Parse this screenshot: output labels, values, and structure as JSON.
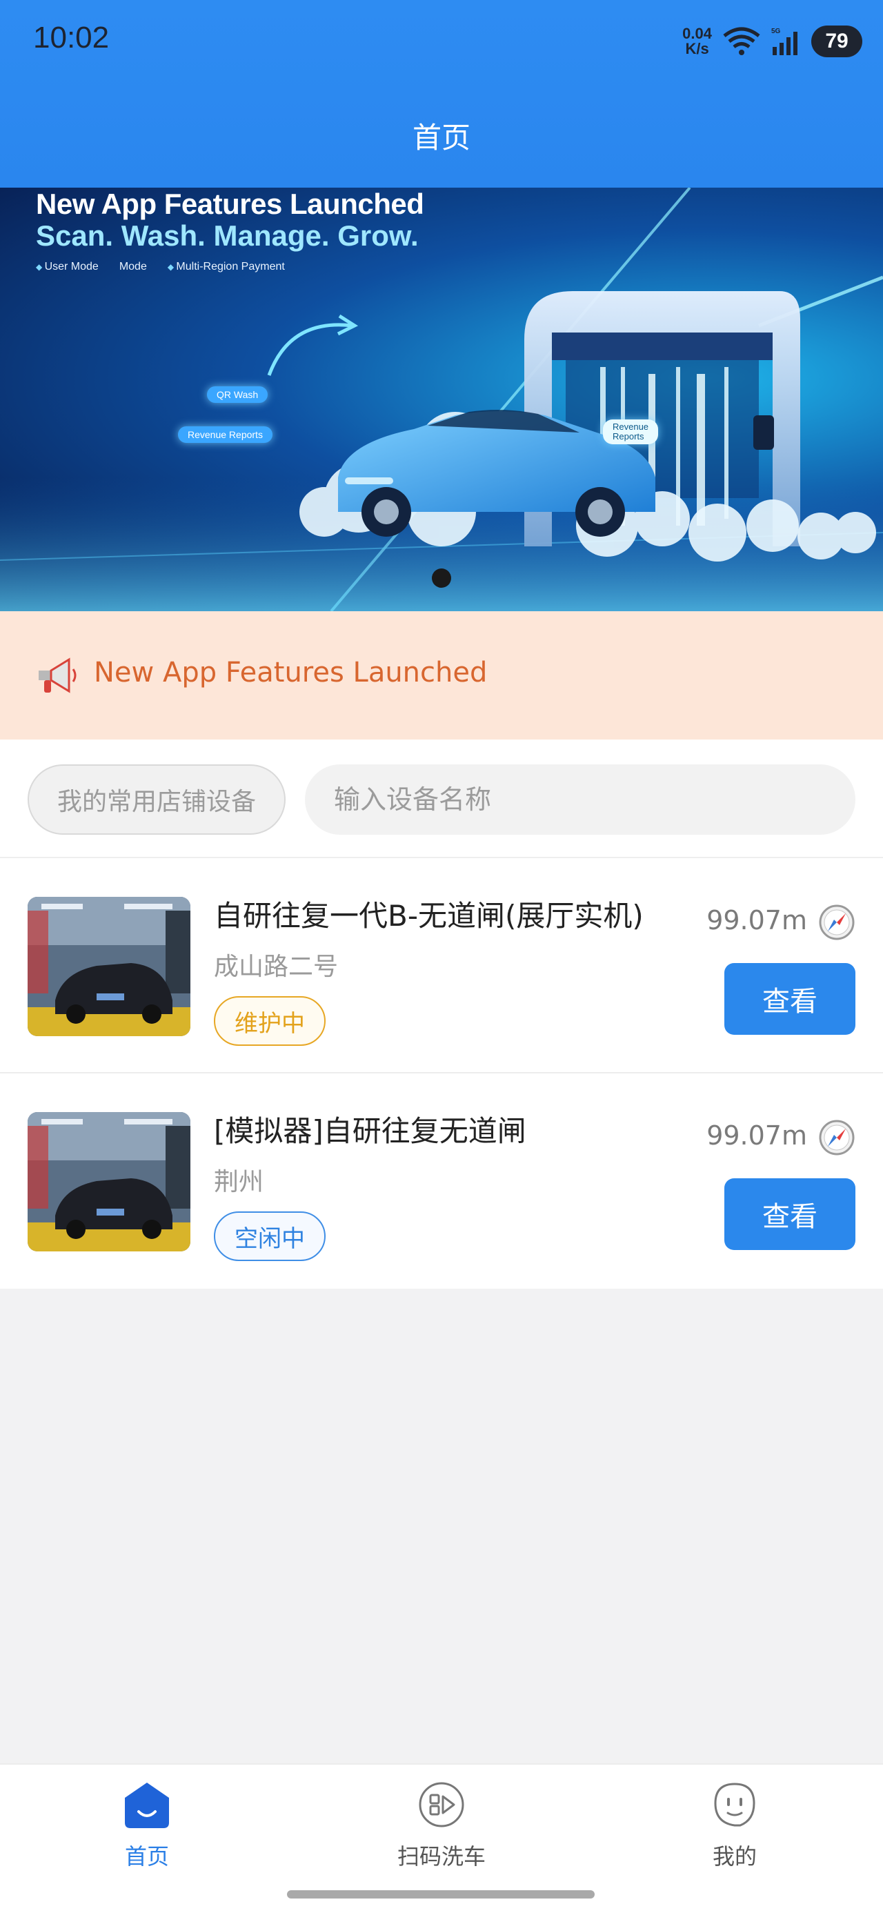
{
  "status_bar": {
    "time": "10:02",
    "net_speed_value": "0.04",
    "net_speed_unit": "K/s",
    "battery": "79"
  },
  "header": {
    "title": "首页"
  },
  "banner": {
    "title": "New App Features Launched",
    "subtitle": "Scan. Wash. Manage. Grow.",
    "features": [
      "User Mode",
      "Mode",
      "Multi-Region Payment"
    ],
    "pill_qr": "QR Wash",
    "pill_revenue": "Revenue Reports",
    "pill_revenue_machine_1": "Revenue",
    "pill_revenue_machine_2": "Reports",
    "slide_count": 1,
    "active_slide": 1
  },
  "notice": {
    "text": "New App Features Launched",
    "icon": "megaphone-icon"
  },
  "search": {
    "fav_label": "我的常用店铺设备",
    "placeholder": "输入设备名称"
  },
  "devices": [
    {
      "name": "自研往复一代B-无道闸(展厅实机)",
      "address": "成山路二号",
      "status": "维护中",
      "status_type": "maintenance",
      "distance": "99.07m",
      "action": "查看"
    },
    {
      "name": "[模拟器]自研往复无道闸",
      "address": "荆州",
      "status": "空闲中",
      "status_type": "idle",
      "distance": "99.07m",
      "action": "查看"
    }
  ],
  "nav": {
    "items": [
      {
        "label": "首页",
        "icon": "home-icon",
        "active": true
      },
      {
        "label": "扫码洗车",
        "icon": "scan-wash-icon",
        "active": false
      },
      {
        "label": "我的",
        "icon": "profile-icon",
        "active": false
      }
    ]
  },
  "colors": {
    "primary": "#2b88ec",
    "notice_bg": "#fde6d8",
    "notice_text": "#d8662f",
    "maintenance": "#e3a21c",
    "idle": "#2f82e0"
  }
}
